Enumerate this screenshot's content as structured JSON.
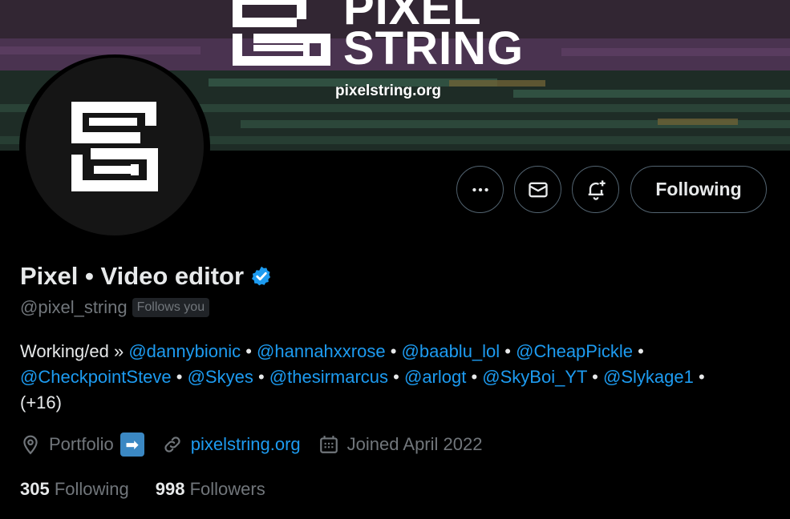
{
  "banner": {
    "wordmark_line1": "PIXEL",
    "wordmark_line2": "STRING",
    "url": "pixelstring.org"
  },
  "actions": {
    "more_icon": "more-horizontal-icon",
    "message_icon": "envelope-icon",
    "notify_icon": "bell-plus-icon",
    "following_label": "Following"
  },
  "profile": {
    "name": "Pixel • Video editor",
    "handle": "@pixel_string",
    "follows_you": "Follows you",
    "bio": {
      "prefix": "Working/ed » ",
      "mentions": [
        "@dannybionic",
        "@hannahxxrose",
        "@baablu_lol",
        "@CheapPickle",
        "@CheckpointSteve",
        "@Skyes",
        "@thesirmarcus",
        "@arlogt",
        "@SkyBoi_YT",
        "@Slykage1"
      ],
      "separator": " • ",
      "suffix": "(+16)"
    },
    "location": "Portfolio",
    "website": "pixelstring.org",
    "joined": "Joined April 2022",
    "following_count": "305",
    "following_label": "Following",
    "followers_count": "998",
    "followers_label": "Followers"
  },
  "colors": {
    "accent": "#1d9bf0",
    "muted": "#71767b",
    "text": "#e7e9ea",
    "background": "#000000"
  }
}
